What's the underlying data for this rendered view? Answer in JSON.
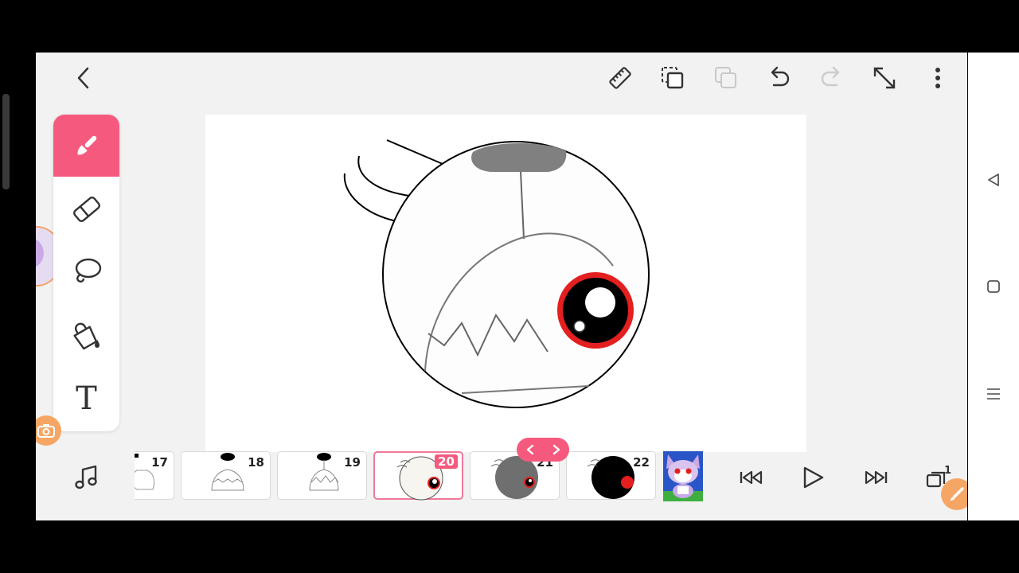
{
  "app": {
    "accent": "#f55a7e",
    "orange": "#f6a664",
    "toolbar": {
      "back_icon": "chevron-left-icon",
      "ruler_icon": "ruler-icon",
      "duplicate_frame_icon": "duplicate-frame-icon",
      "copy_icon": "copy-icon",
      "undo_icon": "undo-icon",
      "redo_icon": "redo-icon",
      "fullscreen_icon": "expand-icon",
      "more_icon": "more-vertical-icon"
    },
    "tools": [
      "brush-icon",
      "eraser-icon",
      "lasso-icon",
      "fill-bucket-icon",
      "text-icon"
    ],
    "text_tool_glyph": "T",
    "frames": [
      {
        "number": "17"
      },
      {
        "number": "18"
      },
      {
        "number": "19"
      },
      {
        "number": "20",
        "selected": true
      },
      {
        "number": "21"
      },
      {
        "number": "22"
      }
    ],
    "playback": [
      "skip-to-start-icon",
      "play-icon",
      "skip-to-end-icon",
      "layers-icon"
    ],
    "layers_badge": "1"
  }
}
